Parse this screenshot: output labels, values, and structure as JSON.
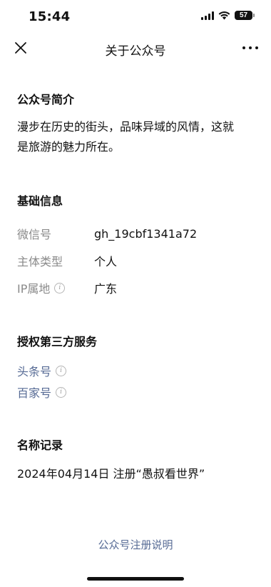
{
  "status_bar": {
    "time": "15:44",
    "battery_level": "57",
    "icons": [
      "signal-icon",
      "wifi-icon",
      "battery-icon"
    ]
  },
  "nav": {
    "title": "关于公众号",
    "close_icon": "close-icon",
    "more_icon": "more-icon"
  },
  "intro": {
    "title": "公众号简介",
    "line1": "漫步在历史的街头，品味异域的风情，这就",
    "line2": "是旅游的魅力所在。"
  },
  "basic_info": {
    "title": "基础信息",
    "rows": [
      {
        "label": "微信号",
        "value": "gh_19cbf1341a72"
      },
      {
        "label": "主体类型",
        "value": "个人"
      },
      {
        "label": "IP属地",
        "value": "广东"
      }
    ]
  },
  "services": {
    "title": "授权第三方服务",
    "items": [
      {
        "label": "头条号"
      },
      {
        "label": "百家号"
      }
    ]
  },
  "name_record": {
    "title": "名称记录",
    "entry": "2024年04月14日 注册“愚叔看世界”"
  },
  "footer": {
    "link": "公众号注册说明"
  },
  "colors": {
    "link": "#576b95",
    "label_gray": "#8a8a8a",
    "text": "#111111"
  }
}
